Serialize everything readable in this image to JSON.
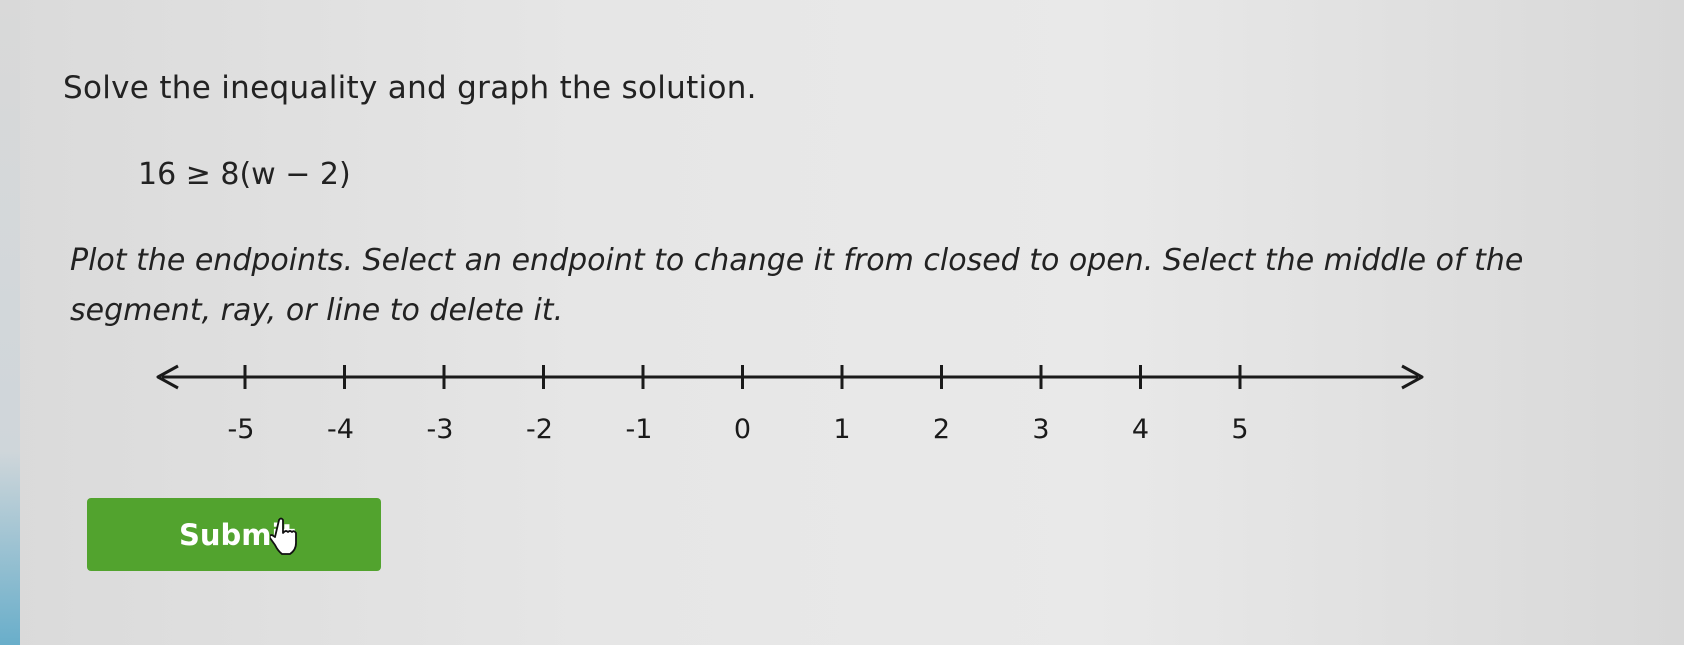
{
  "prompt": {
    "heading": "Solve the inequality and graph the solution.",
    "equation": "16 ≥ 8(w − 2)",
    "instructions": "Plot the endpoints. Select an endpoint to change it from closed to open. Select the middle of the segment, ray, or line to delete it."
  },
  "number_line": {
    "min": -5,
    "max": 5,
    "step": 1,
    "tick_labels": [
      "-5",
      "-4",
      "-3",
      "-2",
      "-1",
      "0",
      "1",
      "2",
      "3",
      "4",
      "5"
    ]
  },
  "submit": {
    "label": "Submit",
    "color": "#52a32e"
  },
  "icons": [
    "left-arrow-icon",
    "right-arrow-icon",
    "hand-pointer-icon"
  ]
}
